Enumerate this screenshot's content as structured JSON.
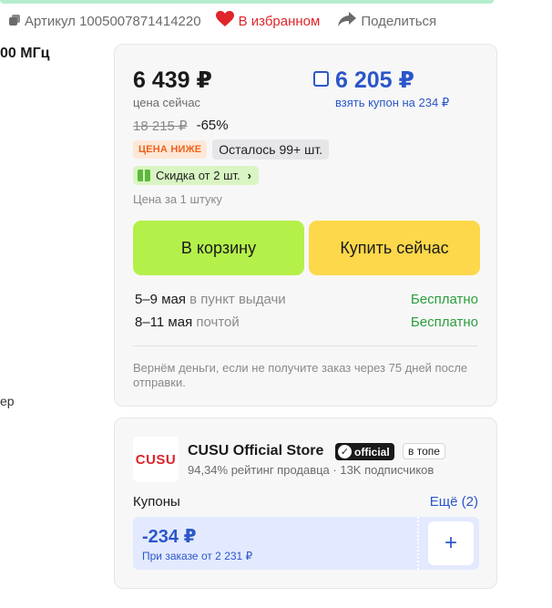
{
  "header": {
    "article_label": "Артикул 1005007871414220",
    "favorite_label": "В избранном",
    "share_label": "Поделиться"
  },
  "left_fragments": {
    "top": "00 МГц",
    "bottom": "ер"
  },
  "price": {
    "current": "6 439 ₽",
    "current_caption": "цена сейчас",
    "coupon_price": "6 205 ₽",
    "coupon_caption": "взять купон на 234 ₽",
    "old": "18 215 ₽",
    "discount": "-65%",
    "badge_low": "ЦЕНА НИЖЕ",
    "stock": "Осталось 99+ шт.",
    "multi_discount": "Скидка от 2 шт.",
    "unit_caption": "Цена за 1 штуку",
    "cart_button": "В корзину",
    "buy_button": "Купить сейчас"
  },
  "delivery": [
    {
      "date": "5–9 мая",
      "method": "в пункт выдачи",
      "cost": "Бесплатно"
    },
    {
      "date": "8–11 мая",
      "method": "почтой",
      "cost": "Бесплатно"
    }
  ],
  "refund_text": "Вернём деньги, если не получите заказ через 75 дней после отправки.",
  "store": {
    "logo_text": "CUSU",
    "name": "CUSU Official Store",
    "official_badge": "official",
    "top_badge": "в топе",
    "stats": "94,34% рейтинг продавца · 13K подписчиков",
    "coupons_label": "Купоны",
    "coupons_more": "Ещё (2)",
    "coupon_amount": "-234 ₽",
    "coupon_condition": "При заказе от 2 231 ₽"
  },
  "colors": {
    "accent_blue": "#2c56c9",
    "favorite_red": "#e0252b",
    "free_green": "#2a9e3c",
    "cart_green": "#b4f04a",
    "buy_yellow": "#fdd84a"
  },
  "icons": {
    "article": "copy-icon",
    "favorite": "heart-icon",
    "share": "share-arrow-icon",
    "gift": "gift-icon",
    "add": "plus-icon",
    "verified": "verified-check-icon"
  }
}
